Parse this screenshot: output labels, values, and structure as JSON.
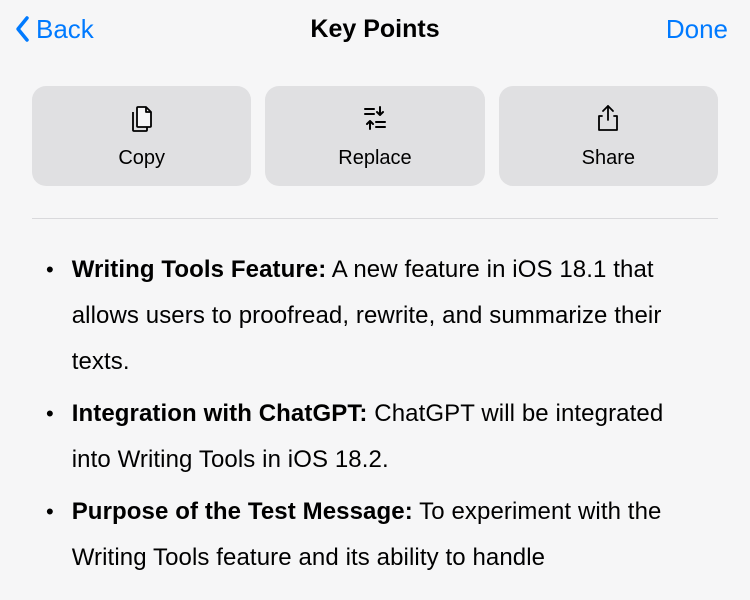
{
  "nav": {
    "back_label": "Back",
    "title": "Key Points",
    "done_label": "Done"
  },
  "actions": {
    "copy_label": "Copy",
    "replace_label": "Replace",
    "share_label": "Share"
  },
  "bullets": [
    {
      "title": "Writing Tools Feature:",
      "body": " A new feature in iOS 18.1 that allows users to proofread, rewrite, and summarize their texts."
    },
    {
      "title": "Integration with ChatGPT:",
      "body": " ChatGPT will be integrated into Writing Tools in iOS 18.2."
    },
    {
      "title": "Purpose of the Test Message:",
      "body": " To experiment with the Writing Tools feature and its ability to handle"
    }
  ]
}
